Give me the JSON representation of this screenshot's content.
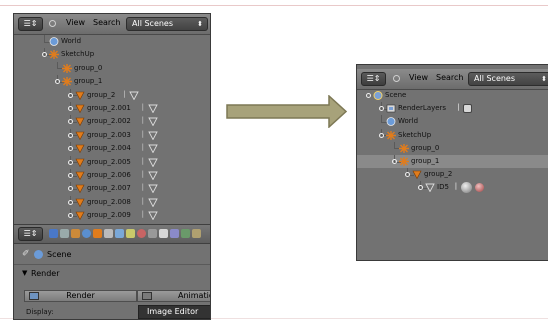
{
  "colors": {
    "panel_bg": "#727272",
    "arrow_fill": "#a7a27a",
    "arrow_stroke": "#7d7855",
    "object_orange": "#e07c1c"
  },
  "left_panel": {
    "header": {
      "view": "View",
      "search": "Search",
      "scene_select": "All Scenes"
    },
    "outliner": [
      {
        "label": "World",
        "icon": "world-icon",
        "depth": 1,
        "expand": false
      },
      {
        "label": "SketchUp",
        "icon": "empty-object-icon",
        "depth": 1,
        "expand": true
      },
      {
        "label": "group_0",
        "icon": "empty-object-icon",
        "depth": 2,
        "expand": false
      },
      {
        "label": "group_1",
        "icon": "empty-object-icon",
        "depth": 2,
        "expand": true
      },
      {
        "label": "group_2",
        "icon": "group-instance-icon",
        "depth": 3,
        "expand": true,
        "mesh": true
      },
      {
        "label": "group_2.001",
        "icon": "group-instance-icon",
        "depth": 3,
        "expand": true,
        "mesh": true
      },
      {
        "label": "group_2.002",
        "icon": "group-instance-icon",
        "depth": 3,
        "expand": true,
        "mesh": true
      },
      {
        "label": "group_2.003",
        "icon": "group-instance-icon",
        "depth": 3,
        "expand": true,
        "mesh": true
      },
      {
        "label": "group_2.004",
        "icon": "group-instance-icon",
        "depth": 3,
        "expand": true,
        "mesh": true
      },
      {
        "label": "group_2.005",
        "icon": "group-instance-icon",
        "depth": 3,
        "expand": true,
        "mesh": true
      },
      {
        "label": "group_2.006",
        "icon": "group-instance-icon",
        "depth": 3,
        "expand": true,
        "mesh": true
      },
      {
        "label": "group_2.007",
        "icon": "group-instance-icon",
        "depth": 3,
        "expand": true,
        "mesh": true
      },
      {
        "label": "group_2.008",
        "icon": "group-instance-icon",
        "depth": 3,
        "expand": true,
        "mesh": true
      },
      {
        "label": "group_2.009",
        "icon": "group-instance-icon",
        "depth": 3,
        "expand": true,
        "mesh": true
      }
    ],
    "properties": {
      "scene_label": "Scene",
      "render_section": "Render",
      "render_button": "Render",
      "animation_button": "Animation",
      "display_label": "Display:",
      "display_value": "Image Editor"
    }
  },
  "right_panel": {
    "header": {
      "view": "View",
      "search": "Search",
      "scene_select": "All Scenes"
    },
    "outliner": [
      {
        "label": "Scene",
        "icon": "scene-icon",
        "depth": 0,
        "expand": true
      },
      {
        "label": "RenderLayers",
        "icon": "render-layers-icon",
        "depth": 1,
        "expand": true,
        "extra": true
      },
      {
        "label": "World",
        "icon": "world-icon",
        "depth": 1,
        "expand": false
      },
      {
        "label": "SketchUp",
        "icon": "empty-object-icon",
        "depth": 1,
        "expand": true
      },
      {
        "label": "group_0",
        "icon": "empty-object-icon",
        "depth": 2,
        "expand": false
      },
      {
        "label": "group_1",
        "icon": "empty-object-icon",
        "depth": 2,
        "expand": true,
        "highlight": true
      },
      {
        "label": "group_2",
        "icon": "group-instance-icon",
        "depth": 3,
        "expand": true
      },
      {
        "label": "ID5",
        "icon": "mesh-icon",
        "depth": 4,
        "expand": true,
        "material": true
      }
    ]
  }
}
